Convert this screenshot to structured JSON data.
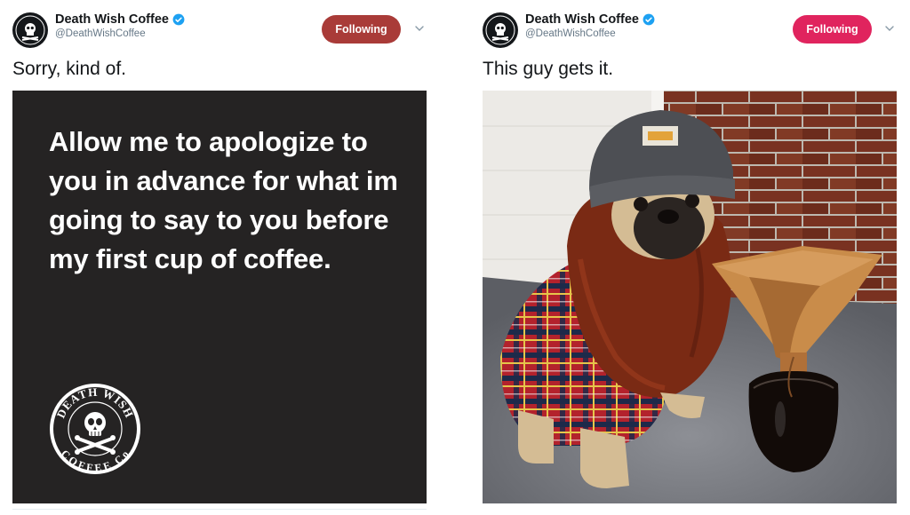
{
  "tweets": [
    {
      "display_name": "Death Wish Coffee",
      "handle": "@DeathWishCoffee",
      "follow_label": "Following",
      "text": "Sorry, kind of.",
      "image_text": "Allow me to apologize to you in advance for what im going to say to you before my first cup of coffee.",
      "verified_color": "#1da1f2",
      "button_color": "#a93b38"
    },
    {
      "display_name": "Death Wish Coffee",
      "handle": "@DeathWishCoffee",
      "follow_label": "Following",
      "text": "This guy gets it.",
      "button_color": "#e0245e"
    }
  ],
  "icons": {
    "avatar": "skull-logo-icon",
    "verified": "verified-badge-icon",
    "menu": "chevron-down-icon",
    "brand": "death-wish-logo-icon"
  },
  "logo": {
    "top": "DEATH WISH",
    "bottom": "COFFEE Co"
  }
}
